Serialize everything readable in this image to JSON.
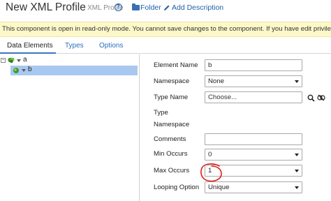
{
  "header": {
    "title": "New XML Profile",
    "subtitle": "- XML Profile",
    "help_icon": "question-circle-icon",
    "folder_label": "Folder",
    "add_description_label": "Add Description",
    "accent_color": "#1f5ea8"
  },
  "banner": {
    "text": "This component is open in read-only mode. You cannot save changes to the component. If you have edit privileges f",
    "background_color": "#fcf8c9"
  },
  "tabs": [
    {
      "label": "Data Elements",
      "active": true
    },
    {
      "label": "Types",
      "active": false
    },
    {
      "label": "Options",
      "active": false
    }
  ],
  "tree": {
    "nodes": [
      {
        "label": "a",
        "expanded": true,
        "selected": false,
        "toggle": "−"
      },
      {
        "label": "b",
        "expanded": false,
        "selected": true
      }
    ],
    "selection_color": "#a8c8ef"
  },
  "form": {
    "element_name": {
      "label": "Element Name",
      "value": "b"
    },
    "namespace": {
      "label": "Namespace",
      "value": "None"
    },
    "type_name": {
      "label": "Type Name",
      "placeholder": "Choose..."
    },
    "type_namespace": {
      "label_line1": "Type",
      "label_line2": "Namespace"
    },
    "comments": {
      "label": "Comments",
      "value": ""
    },
    "min_occurs": {
      "label": "Min Occurs",
      "value": "0"
    },
    "max_occurs": {
      "label": "Max Occurs",
      "value": "1"
    },
    "looping_option": {
      "label": "Looping Option",
      "value": "Unique"
    }
  },
  "annotation": {
    "shape": "hand-drawn red circle around Max Occurs value",
    "color": "#e0201a"
  }
}
